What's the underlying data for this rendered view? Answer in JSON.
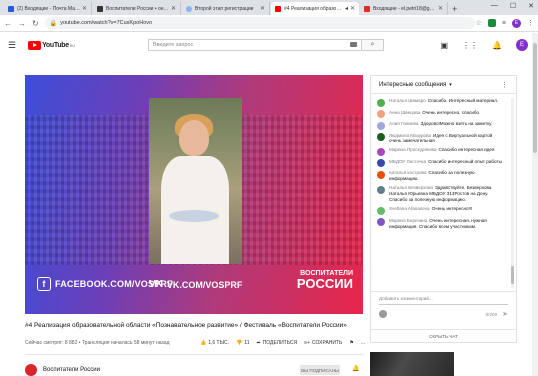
{
  "browser": {
    "tabs": [
      {
        "label": "(2) Входящие - Почта Mail.ru",
        "color": "#2a5bd7"
      },
      {
        "label": "Воспитатели России • онлайн ф",
        "color": "#333333"
      },
      {
        "label": "Второй этап регистрации",
        "color": "#8ab4f8"
      },
      {
        "label": "#4 Реализация образовате",
        "color": "#ff0000"
      },
      {
        "label": "Входящие - el.petri18@gmail.co",
        "color": "#d93025"
      }
    ],
    "active_tab": 3,
    "url": "youtube.com/watch?v=7CusKpoHovo"
  },
  "youtube": {
    "logo": "YouTube",
    "logo_region": "RU",
    "search_placeholder": "Введите запрос",
    "avatar_letter": "E"
  },
  "video": {
    "banner_fb": "FACEBOOK.COM/VOSPRF",
    "banner_vk": "VK.COM/VOSPRF",
    "banner_brand_l1": "ВОСПИТАТЕЛИ",
    "banner_brand_l2": "РОССИИ",
    "title": "#4 Реализация образовательной области «Познавательное развитие» / Фестиваль «Воспитатели России»",
    "meta": "Сейчас смотрят: 8 882 • Трансляция началась 58 минут назад",
    "likes": "1,6 ТЫС.",
    "dislikes": "11",
    "share": "ПОДЕЛИТЬСЯ",
    "save": "СОХРАНИТЬ",
    "more": "...",
    "channel": "Воспитатели России",
    "subscribe": "ВЫ ПОДПИСАНЫ"
  },
  "chat": {
    "header": "Интересные сообщения",
    "messages": [
      {
        "author": "Наталья Шамаро",
        "text": "Спасибо. Интересный материал.",
        "color": "#4caf50"
      },
      {
        "author": "Анна Швецова",
        "text": "Очень интересно, спасибо",
        "color": "#f2a07b"
      },
      {
        "author": "Алия Ганиева",
        "text": "Здорово!Можно взять на заметку.",
        "color": "#9fa8da"
      },
      {
        "author": "Людмила Мазурова",
        "text": "Идея с Виртуальной картой очень замечательная",
        "color": "#1b5e20"
      },
      {
        "author": "Марина Проскурякова",
        "text": "Спасибо интересная идея",
        "color": "#ab47bc"
      },
      {
        "author": "МБДОУ Ласточка",
        "text": "Спасибо интересный опыт работы",
        "color": "#3949ab"
      },
      {
        "author": "наталья кострова",
        "text": "Спасибо за полезную информацию.",
        "color": "#e65100"
      },
      {
        "author": "Наталья Безверхова",
        "text": "Здравствуйте. Безверхова Наталья Юрьевна МБДОУ 313Ростов на Дону. Спасибо за полезную информацию.",
        "color": "#607d8b"
      },
      {
        "author": "Svetlana Afanaseva",
        "text": "Очень интересно!!!",
        "color": "#66bb6a"
      },
      {
        "author": "Марина Березина",
        "text": "Очень интересная, нужная информация. Спасибо всем участникам.",
        "color": "#7e57c2"
      }
    ],
    "compose_placeholder": "Добавить комментарий...",
    "counter": "0/200",
    "hide": "СКРЫТЬ ЧАТ"
  }
}
